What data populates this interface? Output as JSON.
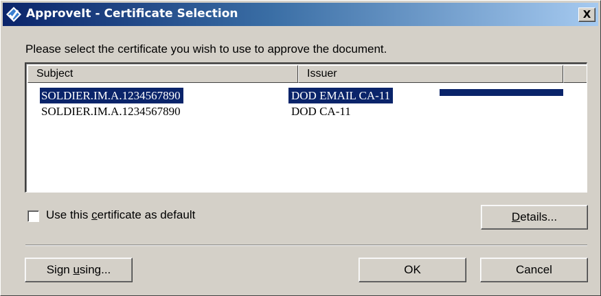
{
  "window": {
    "title": "ApproveIt - Certificate Selection",
    "app_icon": "approveit-logo-icon",
    "close_label": "X",
    "accent_color": "#0a246a"
  },
  "dialog": {
    "instruction": "Please select the certificate you wish to use to approve the document."
  },
  "certificate_list": {
    "columns": [
      "Subject",
      "Issuer"
    ],
    "rows": [
      {
        "subject": "SOLDIER.IM.A.1234567890",
        "issuer": "DOD EMAIL CA-11",
        "selected": true
      },
      {
        "subject": "SOLDIER.IM.A.1234567890",
        "issuer": "DOD CA-11",
        "selected": false
      }
    ]
  },
  "options": {
    "default_checkbox": {
      "label_before": "Use this ",
      "label_mnemonic": "c",
      "label_after": "ertificate as default",
      "checked": false
    }
  },
  "buttons": {
    "details": {
      "mnemonic": "D",
      "rest": "etails..."
    },
    "sign_using": {
      "before": "Sign ",
      "mnemonic": "u",
      "after": "sing..."
    },
    "ok": "OK",
    "cancel": "Cancel"
  }
}
